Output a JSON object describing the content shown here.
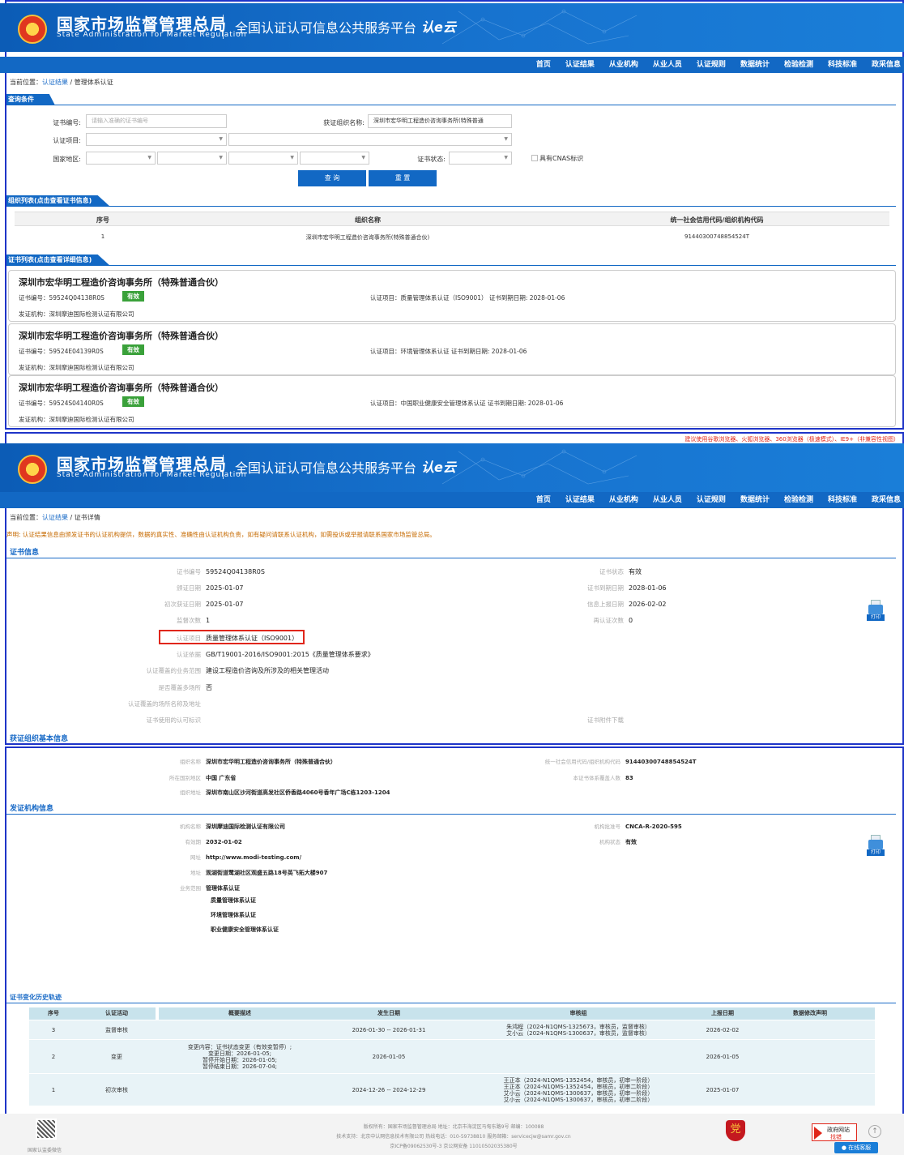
{
  "header": {
    "cn_title": "国家市场监督管理总局",
    "en_title": "State Administration for Market Regulation",
    "platform": "全国认证认可信息公共服务平台",
    "logo_text": "认e云"
  },
  "nav": [
    "首页",
    "认证结果",
    "从业机构",
    "从业人员",
    "认证规则",
    "数据统计",
    "检验检测",
    "科技标准",
    "政采信息"
  ],
  "search_page": {
    "breadcrumb": {
      "prefix": "当前位置：",
      "link": "认证结果",
      "sep": "/",
      "current": "管理体系认证"
    },
    "query_tab": "查询条件",
    "form": {
      "cert_no_label": "证书编号:",
      "cert_no_placeholder": "请输入准确的证书编号",
      "org_name_label": "获证组织名称:",
      "org_name_value": "深圳市宏华明工程造价咨询事务所(特殊普通",
      "cert_item_label": "认证项目:",
      "region_label": "国家地区:",
      "status_label": "证书状态:",
      "cnas_label": "具有CNAS标识",
      "query_btn": "查 询",
      "reset_btn": "重 置"
    },
    "org_tab": "组织列表(点击查看证书信息)",
    "org_table": {
      "headers": [
        "序号",
        "组织名称",
        "统一社会信用代码/组织机构代码"
      ],
      "rows": [
        [
          "1",
          "深圳市宏华明工程造价咨询事务所(特殊普通合伙)",
          "91440300748854524T"
        ]
      ]
    },
    "cert_tab": "证书列表(点击查看详细信息)",
    "certs": [
      {
        "title": "深圳市宏华明工程造价咨询事务所（特殊普通合伙）",
        "no": "证书编号：59524Q04138R0S",
        "status": "有效",
        "item": "认证项目：质量管理体系认证（ISO9001）  证书到期日期: 2028-01-06",
        "org": "发证机构：深圳摩迪国际检测认证有限公司"
      },
      {
        "title": "深圳市宏华明工程造价咨询事务所（特殊普通合伙）",
        "no": "证书编号：59524E04139R0S",
        "status": "有效",
        "item": "认证项目：环境管理体系认证  证书到期日期: 2028-01-06",
        "org": "发证机构：深圳摩迪国际检测认证有限公司"
      },
      {
        "title": "深圳市宏华明工程造价咨询事务所（特殊普通合伙）",
        "no": "证书编号：59524S04140R0S",
        "status": "有效",
        "item": "认证项目：中国职业健康安全管理体系认证  证书到期日期: 2028-01-06",
        "org": "发证机构：深圳摩迪国际检测认证有限公司"
      }
    ]
  },
  "detail_page": {
    "browser_warning": "建议使用谷歌浏览器、火狐浏览器、360浏览器（极速模式）、IE9+（非兼容性视图）",
    "breadcrumb": {
      "prefix": "当前位置：",
      "link": "认证结果",
      "sep": "/",
      "current": "证书详情"
    },
    "notice": "声明: 认证结果信息由颁发证书的认证机构提供，数据的真实性、准确性由认证机构负责，如有疑问请联系认证机构，如需投诉或举报请联系国家市场监管总局。",
    "cert_section": "证书信息",
    "cert_left": [
      {
        "k": "证书编号",
        "v": "59524Q04138R0S"
      },
      {
        "k": "颁证日期",
        "v": "2025-01-07"
      },
      {
        "k": "初次获证日期",
        "v": "2025-01-07"
      },
      {
        "k": "监督次数",
        "v": "1"
      },
      {
        "k": "认证项目",
        "v": "质量管理体系认证（ISO9001）"
      },
      {
        "k": "认证依据",
        "v": "GB/T19001-2016/ISO9001:2015《质量管理体系要求》"
      },
      {
        "k": "认证覆盖的业务范围",
        "v": "建设工程造价咨询及所涉及的相关管理活动"
      },
      {
        "k": "是否覆盖多场所",
        "v": "否"
      },
      {
        "k": "认证覆盖的场所名称及地址",
        "v": ""
      },
      {
        "k": "证书使用的认可标识",
        "v": ""
      }
    ],
    "cert_right": [
      {
        "k": "证书状态",
        "v": "有效"
      },
      {
        "k": "证书到期日期",
        "v": "2028-01-06"
      },
      {
        "k": "信息上报日期",
        "v": "2026-02-02"
      },
      {
        "k": "再认证次数",
        "v": "0"
      },
      {
        "k": "证书附件下载",
        "v": ""
      }
    ],
    "print_label": "打印",
    "org_section": "获证组织基本信息",
    "org_left": [
      {
        "k": "组织名称",
        "v": "深圳市宏华明工程造价咨询事务所（特殊普通合伙）"
      },
      {
        "k": "所在国别地区",
        "v": "中国 广东省"
      },
      {
        "k": "组织地址",
        "v": "深圳市南山区沙河街道高发社区侨香路4060号香年广场C栋1203-1204"
      }
    ],
    "org_right": [
      {
        "k": "统一社会信用代码/组织机构代码",
        "v": "91440300748854524T"
      },
      {
        "k": "本证书体系覆盖人数",
        "v": "83"
      }
    ],
    "issuer_section": "发证机构信息",
    "issuer_left": [
      {
        "k": "机构名称",
        "v": "深圳摩迪国际检测认证有限公司"
      },
      {
        "k": "有效期",
        "v": "2032-01-02"
      },
      {
        "k": "网址",
        "v": "http://www.modi-testing.com/"
      },
      {
        "k": "地址",
        "v": "观湖街道鹭湖社区观盛五路18号英飞拓大楼907"
      },
      {
        "k": "业务范围",
        "v": "管理体系认证"
      }
    ],
    "issuer_scope": [
      "质量管理体系认证",
      "环境管理体系认证",
      "职业健康安全管理体系认证"
    ],
    "issuer_right": [
      {
        "k": "机构批准号",
        "v": "CNCA-R-2020-595"
      },
      {
        "k": "机构状态",
        "v": "有效"
      }
    ],
    "history_section": "证书变化历史轨迹",
    "history_headers": [
      "序号",
      "认证活动",
      "概要描述",
      "发生日期",
      "审核组",
      "上报日期",
      "数据修改声明"
    ],
    "history_rows": [
      {
        "no": "3",
        "act": "监督审核",
        "desc": "",
        "date": "2026-01-30 -- 2026-01-31",
        "team": "朱鸿程（2024-N1QMS-1325673，审核员，监督审核）\n艾小云（2024-N1QMS-1300637，审核员，监督审核）",
        "report": "2026-02-02",
        "decl": ""
      },
      {
        "no": "2",
        "act": "变更",
        "desc": "变更内容：证书状态变更（有效变暂停）;\n变更日期：2026-01-05;\n暂停开始日期：2026-01-05;\n暂停结束日期：2026-07-04;",
        "date": "2026-01-05",
        "team": "",
        "report": "2026-01-05",
        "decl": ""
      },
      {
        "no": "1",
        "act": "初次审核",
        "desc": "",
        "date": "2024-12-26 -- 2024-12-29",
        "team": "王正本（2024-N1QMS-1352454，审核员，初审一阶段）\n王正本（2024-N1QMS-1352454，审核员，初审二阶段）\n艾小云（2024-N1QMS-1300637，审核员，初审一阶段）\n艾小云（2024-N1QMS-1300637，审核员，初审二阶段）",
        "report": "2025-01-07",
        "decl": ""
      }
    ],
    "footer": {
      "line1": "版权所有：国家市场监督管理总局  地址：北京市海淀区马甸东路9号  邮编：100088",
      "line2": "技术支持：北京中认网信息技术有限公司  热线电话：010-59738810  服务邮箱：servicecjw@samr.gov.cn",
      "line3": "京ICP备09062530号-3  京公网安备 11010502035380号",
      "qr_label": "国家认监委微信",
      "gov_a": "政府网站",
      "gov_b": "找错",
      "chat": "在线客服",
      "shield": "党"
    }
  }
}
